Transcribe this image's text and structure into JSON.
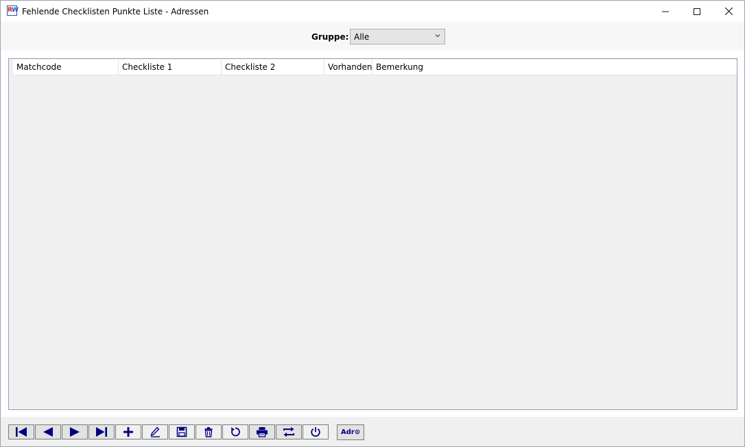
{
  "window": {
    "title": "Fehlende Checklisten Punkte Liste - Adressen",
    "icon_letters": [
      "R",
      "W"
    ]
  },
  "filter": {
    "label": "Gruppe:",
    "selected": "Alle"
  },
  "grid": {
    "columns": [
      "Matchcode",
      "Checkliste 1",
      "Checkliste 2",
      "Vorhanden",
      "Bemerkung"
    ],
    "rows": []
  },
  "toolbar": {
    "buttons": [
      "first-record",
      "previous-record",
      "next-record",
      "last-record",
      "add",
      "edit",
      "save",
      "delete",
      "refresh",
      "print",
      "swap",
      "exit"
    ],
    "adr_label": "Adr⊙"
  },
  "colors": {
    "accent": "#000080",
    "grid_border": "#8ea0b8"
  }
}
